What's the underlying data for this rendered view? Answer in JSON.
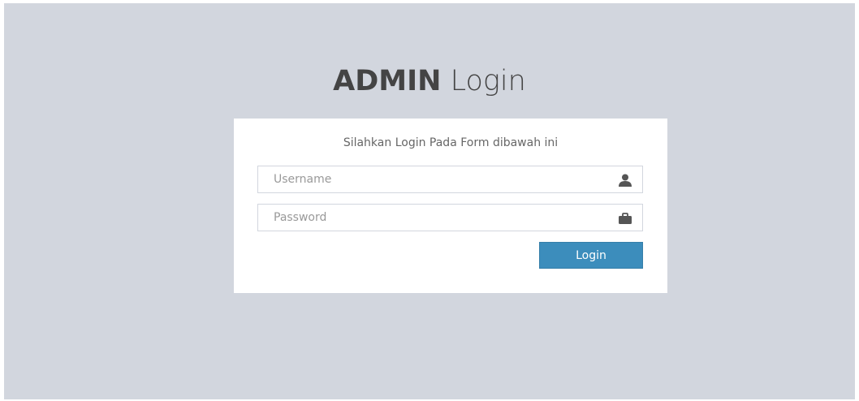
{
  "logo": {
    "bold": "ADMIN",
    "light": "Login"
  },
  "login_box": {
    "message": "Silahkan Login Pada Form dibawah ini",
    "username": {
      "value": "",
      "placeholder": "Username",
      "icon": "user-icon"
    },
    "password": {
      "value": "",
      "placeholder": "Password",
      "icon": "briefcase-icon"
    },
    "submit_label": "Login"
  },
  "colors": {
    "background": "#d2d6de",
    "box": "#ffffff",
    "button": "#3c8dbc",
    "icon": "#555555"
  }
}
